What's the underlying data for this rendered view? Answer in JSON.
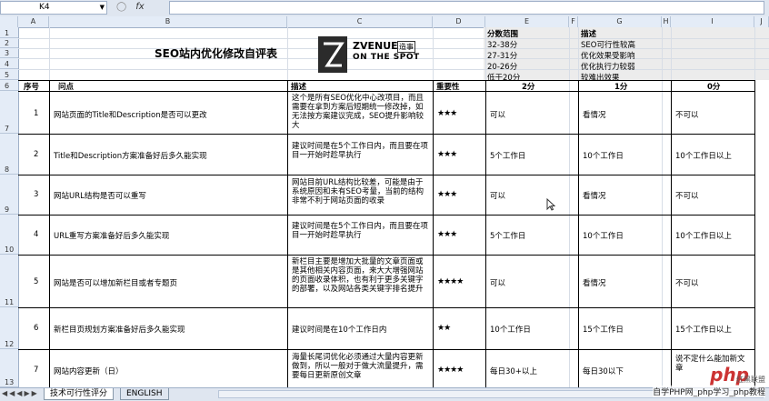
{
  "formula_bar": {
    "name_box": "K4",
    "fx": "fx",
    "formula": ""
  },
  "columns": [
    "A",
    "B",
    "C",
    "D",
    "E",
    "F",
    "G",
    "H",
    "I",
    "J"
  ],
  "rows": [
    "1",
    "2",
    "3",
    "4",
    "5",
    "6",
    "7",
    "8",
    "9",
    "10",
    "11",
    "12",
    "13"
  ],
  "title": "SEO站内优化修改自评表",
  "logo": {
    "name": "ZVENUE",
    "sub": "ON THE SPOT",
    "badge": "造事"
  },
  "score_range": {
    "header": "分数范围",
    "items": [
      "32-38分",
      "27-31分",
      "20-26分",
      "低于20分"
    ]
  },
  "score_desc": {
    "header": "描述",
    "items": [
      "SEO可行性较高",
      "优化效果受影响",
      "优化执行力较弱",
      "较难出效果"
    ]
  },
  "table_headers": {
    "num": "序号",
    "question": "问点",
    "desc": "描述",
    "importance": "重要性",
    "s2": "2分",
    "s1": "1分",
    "s0": "0分"
  },
  "table_rows": [
    {
      "num": "1",
      "question": "网站页面的Title和Description是否可以更改",
      "desc": "这个是所有SEO优化中心改项目，而且需要在拿到方案后短期统一修改掉，如无法按方案建议完成，SEO提升影响较大",
      "importance": "★★★",
      "s2": "可以",
      "s1": "看情况",
      "s0": "不可以"
    },
    {
      "num": "2",
      "question": "Title和Description方案准备好后多久能实现",
      "desc": "建议时间是在5个工作日内，而且要在项目一开始时趁早执行",
      "importance": "★★★",
      "s2": "5个工作日",
      "s1": "10个工作日",
      "s0": "10个工作日以上"
    },
    {
      "num": "3",
      "question": "网站URL结构是否可以重写",
      "desc": "网站目前URL结构比较差，可能是由于系统原因和未有SEO考量，当前的结构非常不利于网站页面的收录",
      "importance": "★★★",
      "s2": "可以",
      "s1": "看情况",
      "s0": "不可以"
    },
    {
      "num": "4",
      "question": "URL重写方案准备好后多久能实现",
      "desc": "建议时间是在5个工作日内，而且要在项目一开始时趁早执行",
      "importance": "★★★",
      "s2": "5个工作日",
      "s1": "10个工作日",
      "s0": "10个工作日以上"
    },
    {
      "num": "5",
      "question": "网站是否可以增加新栏目或者专题页",
      "desc": "新栏目主要是增加大批量的文章页面或是其他相关内容页面，来大大增强网站的页面收录体积，也有利于更多关键字的部署，以及网站各类关键字排名提升",
      "importance": "★★★★",
      "s2": "可以",
      "s1": "看情况",
      "s0": "不可以"
    },
    {
      "num": "6",
      "question": "新栏目页规划方案准备好后多久能实现",
      "desc": "建议时间是在10个工作日内",
      "importance": "★★",
      "s2": "10个工作日",
      "s1": "15个工作日",
      "s0": "15个工作日以上"
    },
    {
      "num": "7",
      "question": "网站内容更新（日）",
      "desc": "海量长尾词优化必须通过大量内容更新做到，所以一般对于做大流量提升，需要每日更新原创文章",
      "importance": "★★★★",
      "s2": "每日30+以上",
      "s1": "每日30以下",
      "s0": "说不定什么能加新文章"
    }
  ],
  "sheet_tabs": [
    "技术可行性评分",
    "ENGLISH"
  ],
  "watermark": {
    "logo": "php",
    "sub": "红黑联盟",
    "text": "自学PHP网_php学习_php教程"
  }
}
